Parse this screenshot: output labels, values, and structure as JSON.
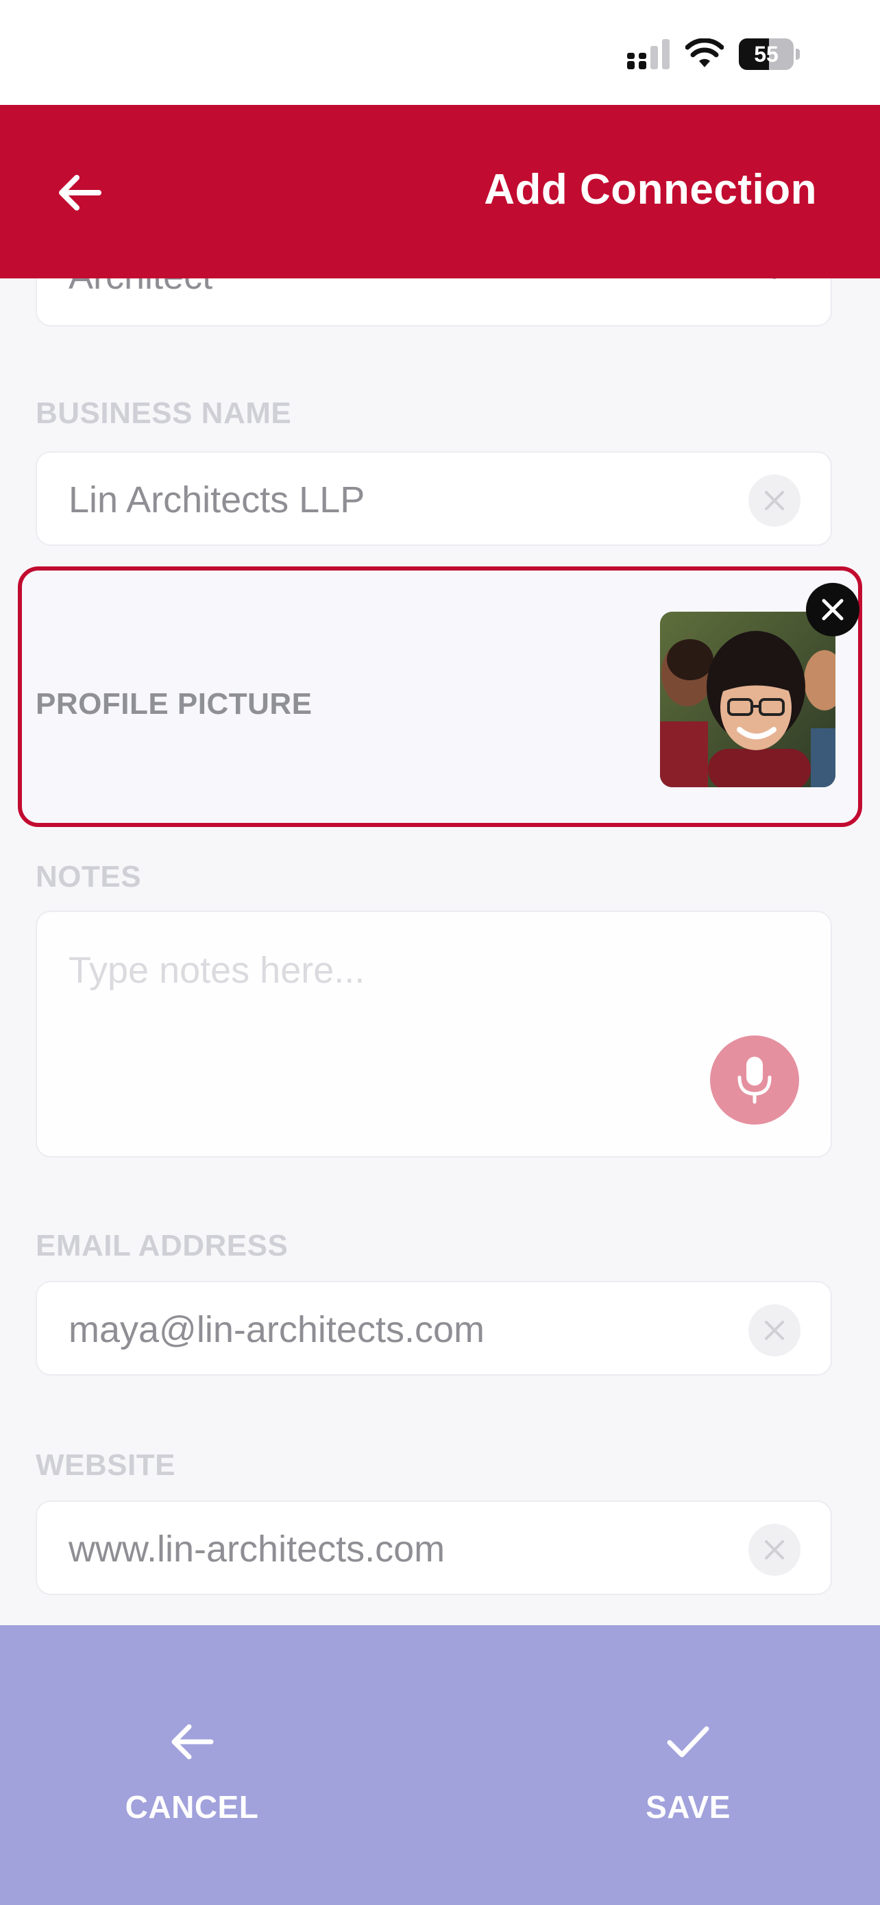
{
  "status_bar": {
    "battery_level": "55",
    "icons": [
      "cellular-signal-icon",
      "wifi-icon",
      "battery-icon"
    ]
  },
  "header": {
    "title": "Add Connection",
    "back_icon": "arrow-left-icon"
  },
  "colors": {
    "brand": "#C20B30",
    "bottom_bar": "#A1A1DC",
    "mic_button": "#E5909F"
  },
  "form": {
    "role": {
      "value": "Architect"
    },
    "business_name": {
      "label": "BUSINESS NAME",
      "value": "Lin Architects LLP"
    },
    "profile_picture": {
      "label": "PROFILE PICTURE"
    },
    "notes": {
      "label": "NOTES",
      "placeholder": "Type notes here..."
    },
    "email": {
      "label": "EMAIL ADDRESS",
      "value": "maya@lin-architects.com"
    },
    "website": {
      "label": "WEBSITE",
      "value": "www.lin-architects.com"
    }
  },
  "bottom_bar": {
    "cancel_label": "CANCEL",
    "save_label": "SAVE"
  }
}
